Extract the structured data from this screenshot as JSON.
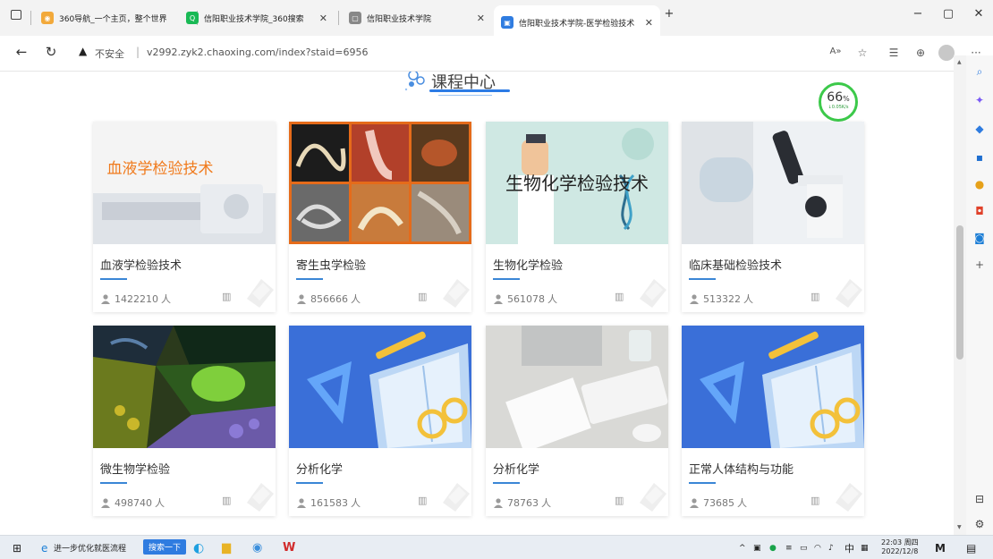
{
  "browser": {
    "tabs": [
      {
        "title": "360导航_一个主页，整个世界",
        "color": "#f2a93b",
        "fav": "◉"
      },
      {
        "title": "信阳职业技术学院_360搜索",
        "color": "#19b955",
        "fav": "Q"
      },
      {
        "title": "信阳职业技术学院",
        "color": "#888888",
        "fav": "▢"
      },
      {
        "title": "信阳职业技术学院-医学检验技术",
        "color": "#2f7ce0",
        "fav": "▣",
        "active": true
      }
    ],
    "new_tab": "+",
    "address": {
      "security": "不安全",
      "url": "v2992.zyk2.chaoxing.com/index?staid=6956"
    }
  },
  "page": {
    "section_title": "课程中心",
    "speed_widget": {
      "percent": "66",
      "unit": "%",
      "rate": "0.05K/s"
    },
    "courses": [
      {
        "name": "血液学检验技术",
        "count": "1422210",
        "unit": "人",
        "thumb_text": "血液学检验技术",
        "thumb": "lab"
      },
      {
        "name": "寄生虫学检验",
        "count": "856666",
        "unit": "人",
        "thumb_text": "",
        "thumb": "parasite"
      },
      {
        "name": "生物化学检验",
        "count": "561078",
        "unit": "人",
        "thumb_text": "生物化学检验技术",
        "thumb": "biochem"
      },
      {
        "name": "临床基础检验技术",
        "count": "513322",
        "unit": "人",
        "thumb_text": "",
        "thumb": "microscope"
      },
      {
        "name": "微生物学检验",
        "count": "498740",
        "unit": "人",
        "thumb_text": "",
        "thumb": "microbe"
      },
      {
        "name": "分析化学",
        "count": "161583",
        "unit": "人",
        "thumb_text": "",
        "thumb": "book"
      },
      {
        "name": "分析化学",
        "count": "78763",
        "unit": "人",
        "thumb_text": "",
        "thumb": "desk"
      },
      {
        "name": "正常人体结构与功能",
        "count": "73685",
        "unit": "人",
        "thumb_text": "",
        "thumb": "book"
      }
    ]
  },
  "taskbar": {
    "ie_text": "进一步优化就医流程",
    "search_btn": "搜索一下",
    "tray_lang": "中",
    "time": "22:03 周四",
    "date": "2022/12/8"
  },
  "colors": {
    "accent": "#2f7ce0",
    "book_blue": "#3a6fd8",
    "speed_ring": "#3cc94a"
  }
}
